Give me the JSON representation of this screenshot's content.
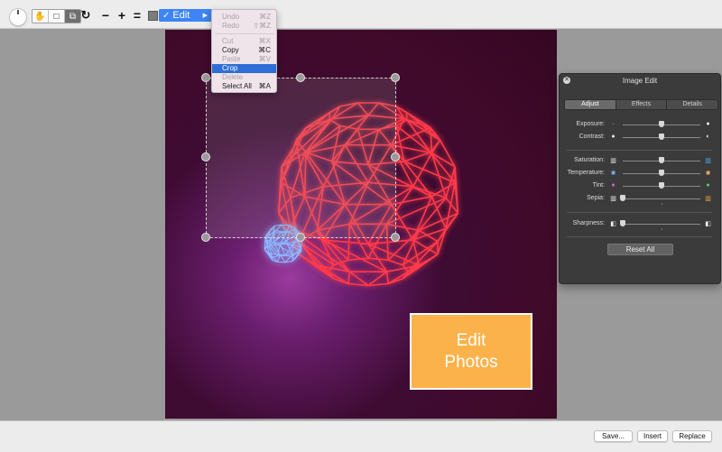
{
  "toolbar": {
    "tools": [
      {
        "name": "rotate-dial-icon"
      },
      {
        "name": "hand-tool-icon",
        "glyph": "✋"
      },
      {
        "name": "marquee-tool-icon",
        "glyph": "□"
      },
      {
        "name": "crop-tool-icon",
        "glyph": "⧉"
      },
      {
        "name": "rotate-icon",
        "glyph": "↻"
      },
      {
        "name": "zoom-out-icon",
        "glyph": "−"
      },
      {
        "name": "zoom-in-icon",
        "glyph": "+"
      },
      {
        "name": "actual-size-icon",
        "glyph": "="
      }
    ],
    "edit_menu_label": "Edit",
    "edit_menu_check": "✓",
    "edit_menu_arrow": "▶"
  },
  "edit_dropdown": {
    "items": [
      {
        "label": "Undo",
        "shortcut": "⌘Z",
        "enabled": false
      },
      {
        "label": "Redo",
        "shortcut": "⇧⌘Z",
        "enabled": false
      },
      {
        "label": "Cut",
        "shortcut": "⌘X",
        "enabled": false
      },
      {
        "label": "Copy",
        "shortcut": "⌘C",
        "enabled": true
      },
      {
        "label": "Paste",
        "shortcut": "⌘V",
        "enabled": false
      },
      {
        "label": "Crop",
        "shortcut": "",
        "enabled": true,
        "selected": true
      },
      {
        "label": "Delete",
        "shortcut": "",
        "enabled": false
      },
      {
        "label": "Select All",
        "shortcut": "⌘A",
        "enabled": true
      }
    ]
  },
  "canvas": {
    "overlay_text_line1": "Edit",
    "overlay_text_line2": "Photos",
    "overlay_color": "#fcb24a"
  },
  "image_edit_panel": {
    "title": "Image Edit",
    "close_glyph": "✕",
    "tabs": [
      {
        "label": "Adjust",
        "active": true
      },
      {
        "label": "Effects",
        "active": false
      },
      {
        "label": "Details",
        "active": false
      }
    ],
    "sliders": {
      "exposure": {
        "label": "Exposure:",
        "value": 0.5
      },
      "contrast": {
        "label": "Contrast:",
        "value": 0.5
      },
      "saturation": {
        "label": "Saturation:",
        "value": 0.5
      },
      "temperature": {
        "label": "Temperature:",
        "value": 0.5
      },
      "tint": {
        "label": "Tint:",
        "value": 0.5
      },
      "sepia": {
        "label": "Sepia:",
        "value": 0.0
      },
      "sharpness": {
        "label": "Sharpness:",
        "value": 0.0
      }
    },
    "reset_label": "Reset All"
  },
  "footer": {
    "save_label": "Save...",
    "insert_label": "Insert",
    "replace_label": "Replace"
  },
  "colors": {
    "accent": "#3d84f6",
    "menu_selected": "#2f6ed6",
    "wire_red": "#ff3a4a",
    "wire_blue": "#8fb6ff"
  }
}
